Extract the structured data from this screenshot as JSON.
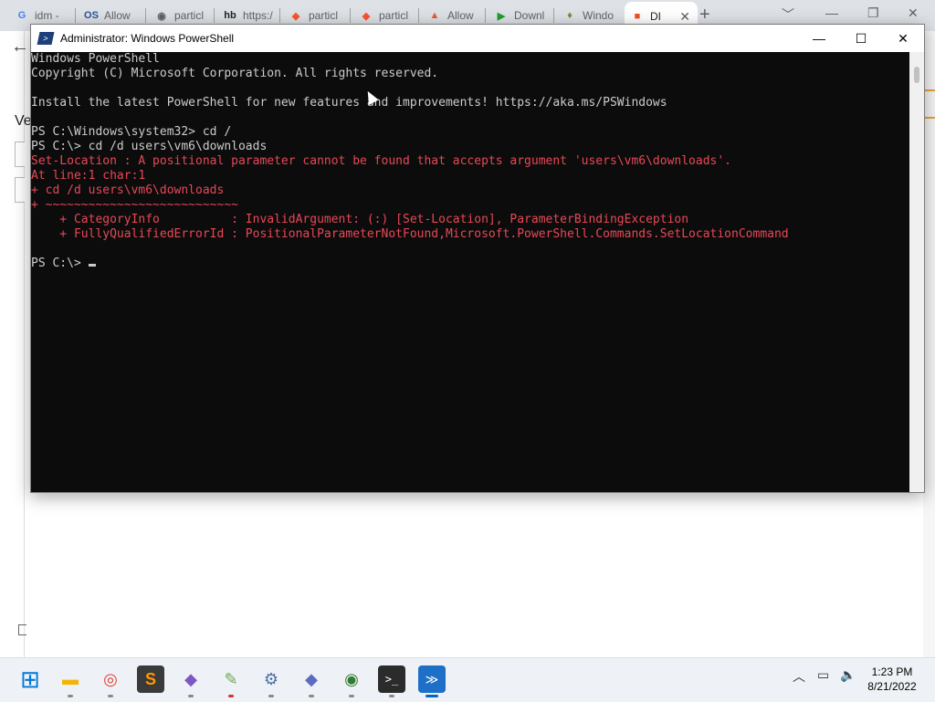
{
  "browser": {
    "tabs": [
      {
        "label": "idm -",
        "icon": "G",
        "icon_name": "google-icon",
        "icon_color": "#4285f4",
        "icon_bg": "transparent"
      },
      {
        "label": "Allow",
        "icon": "OS",
        "icon_name": "os-icon",
        "icon_color": "#2b5797",
        "icon_bg": "transparent"
      },
      {
        "label": "particl",
        "icon": "◉",
        "icon_name": "globe-icon",
        "icon_color": "#5f6368",
        "icon_bg": "transparent"
      },
      {
        "label": "https:/",
        "icon": "hb",
        "icon_name": "hb-icon",
        "icon_color": "#222222",
        "icon_bg": "transparent"
      },
      {
        "label": "particl",
        "icon": "◆",
        "icon_name": "brave-icon",
        "icon_color": "#fb542b",
        "icon_bg": "transparent"
      },
      {
        "label": "particl",
        "icon": "◆",
        "icon_name": "brave-icon",
        "icon_color": "#fb542b",
        "icon_bg": "transparent"
      },
      {
        "label": "Allow",
        "icon": "▲",
        "icon_name": "rainbow-icon",
        "icon_color": "#e55c2f",
        "icon_bg": "transparent"
      },
      {
        "label": "Downl",
        "icon": "▶",
        "icon_name": "play-icon",
        "icon_color": "#1c9e2a",
        "icon_bg": "transparent"
      },
      {
        "label": "Windo",
        "icon": "♦",
        "icon_name": "app-icon",
        "icon_color": "#7a8b3a",
        "icon_bg": "transparent"
      },
      {
        "label": "DI",
        "icon": "■",
        "icon_name": "windows-color-icon",
        "icon_color": "#f25022",
        "icon_bg": "transparent"
      }
    ],
    "new_tab": "+",
    "side_text": "Ve"
  },
  "powershell": {
    "title": "Administrator: Windows PowerShell",
    "lines": [
      {
        "text": "Windows PowerShell",
        "type": "normal"
      },
      {
        "text": "Copyright (C) Microsoft Corporation. All rights reserved.",
        "type": "normal"
      },
      {
        "text": "",
        "type": "normal"
      },
      {
        "text": "Install the latest PowerShell for new features and improvements! https://aka.ms/PSWindows",
        "type": "normal"
      },
      {
        "text": "",
        "type": "normal"
      },
      {
        "text": "PS C:\\Windows\\system32> cd /",
        "type": "normal"
      },
      {
        "text": "PS C:\\> cd /d users\\vm6\\downloads",
        "type": "normal"
      },
      {
        "text": "Set-Location : A positional parameter cannot be found that accepts argument 'users\\vm6\\downloads'.",
        "type": "error"
      },
      {
        "text": "At line:1 char:1",
        "type": "error"
      },
      {
        "text": "+ cd /d users\\vm6\\downloads",
        "type": "error"
      },
      {
        "text": "+ ~~~~~~~~~~~~~~~~~~~~~~~~~~~",
        "type": "error"
      },
      {
        "text": "    + CategoryInfo          : InvalidArgument: (:) [Set-Location], ParameterBindingException",
        "type": "error"
      },
      {
        "text": "    + FullyQualifiedErrorId : PositionalParameterNotFound,Microsoft.PowerShell.Commands.SetLocationCommand",
        "type": "error"
      },
      {
        "text": "",
        "type": "normal"
      }
    ],
    "prompt": "PS C:\\> "
  },
  "colors": {
    "console_bg": "#0c0c0c",
    "console_text": "#cccccc",
    "error_text": "#e74856",
    "taskbar_bg": "#eef1f5",
    "accent": "#0067c0"
  },
  "taskbar": {
    "icons": [
      {
        "name": "start-icon",
        "glyph": "⊞",
        "color": "#0078d4",
        "dot": "none"
      },
      {
        "name": "file-explorer-icon",
        "glyph": "▬",
        "color": "#f4b400",
        "dot": "gray"
      },
      {
        "name": "chrome-icon",
        "glyph": "◎",
        "color": "#db4437",
        "dot": "gray"
      },
      {
        "name": "sublime-text-icon",
        "glyph": "S",
        "color": "#ff9800",
        "dot": "none"
      },
      {
        "name": "visual-studio-icon",
        "glyph": "◆",
        "color": "#7e57c2",
        "dot": "gray"
      },
      {
        "name": "notepad-plus-icon",
        "glyph": "✎",
        "color": "#6aa84f",
        "dot": "red"
      },
      {
        "name": "settings-icon",
        "glyph": "⚙",
        "color": "#4a6fa5",
        "dot": "gray"
      },
      {
        "name": "visual-studio-code-icon",
        "glyph": "◆",
        "color": "#5c6bc0",
        "dot": "gray"
      },
      {
        "name": "network-globe-icon",
        "glyph": "◉",
        "color": "#2e7d32",
        "dot": "gray"
      },
      {
        "name": "terminal-icon",
        "glyph": ">_",
        "color": "#333333",
        "dot": "gray"
      },
      {
        "name": "powershell-icon",
        "glyph": "≫",
        "color": "#1e6fc7",
        "dot": "active"
      }
    ],
    "tray": [
      {
        "name": "chevron-up-icon",
        "glyph": "︿"
      },
      {
        "name": "network-monitor-icon",
        "glyph": "▭"
      },
      {
        "name": "volume-icon",
        "glyph": "🔈"
      }
    ],
    "time": "1:23 PM",
    "date": "8/21/2022"
  }
}
